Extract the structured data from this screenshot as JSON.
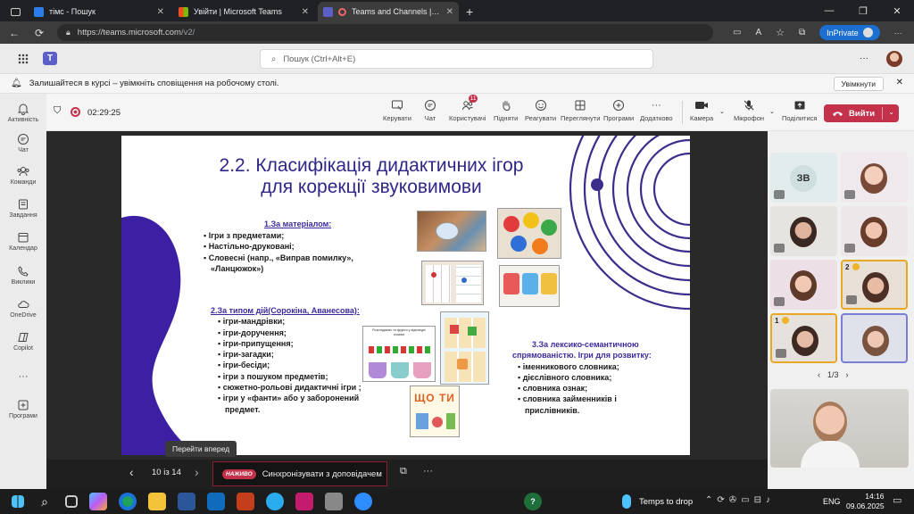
{
  "browser": {
    "tabs": [
      {
        "title": "тімс - Пошук",
        "active": false
      },
      {
        "title": "Увійти | Microsoft Teams",
        "active": false
      },
      {
        "title": "Teams and Channels | Захис",
        "active": true
      }
    ],
    "url_domain": "https://teams.microsoft.com",
    "url_path": "/v2/",
    "inprivate_label": "InPrivate"
  },
  "teams": {
    "search_placeholder": "Пошук (Ctrl+Alt+E)",
    "notification": {
      "text": "Залишайтеся в курсі – увімкніть сповіщення на робочому столі.",
      "button": "Увімкнути"
    },
    "rail": [
      {
        "label": "Активність",
        "icon": "bell-icon"
      },
      {
        "label": "Чат",
        "icon": "chat-icon"
      },
      {
        "label": "Команди",
        "icon": "teams-icon"
      },
      {
        "label": "Завдання",
        "icon": "assignments-icon"
      },
      {
        "label": "Календар",
        "icon": "calendar-icon"
      },
      {
        "label": "Виклики",
        "icon": "phone-icon"
      },
      {
        "label": "OneDrive",
        "icon": "cloud-icon"
      },
      {
        "label": "Copilot",
        "icon": "copilot-icon"
      },
      {
        "label": "Програми",
        "icon": "apps-icon"
      }
    ]
  },
  "meeting": {
    "timer": "02:29:25",
    "toolbar": [
      {
        "label": "Керувати",
        "icon": "manage-icon"
      },
      {
        "label": "Чат",
        "icon": "chat-icon"
      },
      {
        "label": "Користувачі",
        "icon": "people-icon",
        "badge": "11"
      },
      {
        "label": "Підняти",
        "icon": "hand-icon"
      },
      {
        "label": "Реагувати",
        "icon": "emoji-icon"
      },
      {
        "label": "Переглянути",
        "icon": "view-icon"
      },
      {
        "label": "Програми",
        "icon": "add-apps-icon"
      },
      {
        "label": "Додатково",
        "icon": "more-icon"
      }
    ],
    "camera_label": "Камера",
    "mic_label": "Мікрофон",
    "share_label": "Поділитися",
    "leave_label": "Вийти",
    "slide_nav": {
      "position": "10 із 14",
      "tooltip": "Перейти вперед",
      "live_badge": "НАЖИВО",
      "sync_label": "Синхронізувати з доповідачем"
    },
    "participants": {
      "initials_tile": "ЗВ",
      "pagination": "1/3",
      "hand_numbers": [
        "2",
        "1"
      ]
    }
  },
  "slide": {
    "title_line1": "2.2. Класифікація дидактичних ігор",
    "title_line2": "для корекції звуковимови",
    "section1": {
      "heading": "1.За матеріалом:",
      "items": [
        "Ігри з предметами;",
        "Настільно-друковані;",
        "Словесні (напр., «Виправ помилку»,",
        "«Ланцюжок»)"
      ]
    },
    "section2": {
      "heading": "2.За типом дій(Сорокіна,  Аванесова):",
      "items": [
        "ігри-мандрівки;",
        "ігри-доручення;",
        "ігри-припущення;",
        "ігри-загадки;",
        "ігри-бесіди;",
        "ігри з пошуком предметів;",
        "сюжетно-рольові дидактичні ігри ;",
        "ігри у «фанти» або у заборонений",
        "предмет."
      ]
    },
    "section3": {
      "heading1": "3.За лексико-семантичною",
      "heading2": "спрямованістю. Ігри для розвитку:",
      "items": [
        "іменникового словника;",
        "дієслівного словника;",
        "словника ознак;",
        "словника займенників і",
        "прислівників."
      ]
    },
    "pic_caption": "Розкладаємо та фрукти у відповідні кошики",
    "pic_text": "ЩО ТИ"
  },
  "taskbar": {
    "weather": "Temps to drop",
    "lang": "ENG",
    "time": "14:16",
    "date": "09.06.2025"
  },
  "colors": {
    "teams_purple": "#5b5fc7",
    "leave_red": "#c4314b",
    "slide_indigo": "#2d2a8c",
    "slide_purple": "#4b2dae"
  }
}
